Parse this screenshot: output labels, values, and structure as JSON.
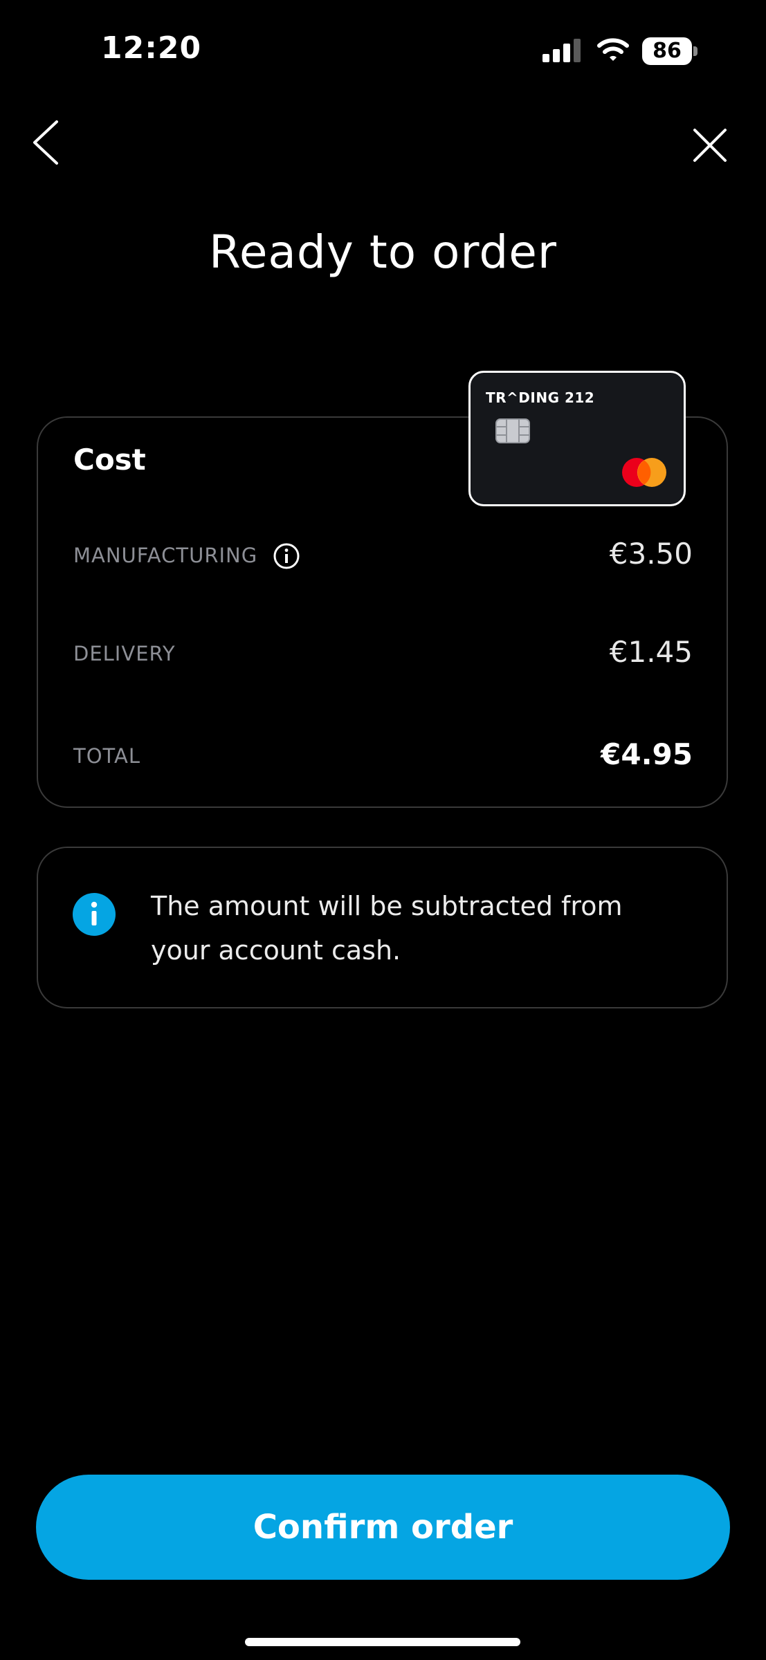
{
  "status_bar": {
    "time": "12:20",
    "battery": "86"
  },
  "page": {
    "title": "Ready to order"
  },
  "card_graphic": {
    "brand": "TR^DING 212"
  },
  "cost": {
    "heading": "Cost",
    "rows": [
      {
        "label": "MANUFACTURING",
        "value": "€3.50"
      },
      {
        "label": "DELIVERY",
        "value": "€1.45"
      },
      {
        "label": "TOTAL",
        "value": "€4.95"
      }
    ]
  },
  "info": {
    "text": "The amount will be subtracted from your account cash."
  },
  "actions": {
    "confirm_label": "Confirm order"
  },
  "colors": {
    "accent": "#05a5e3",
    "background": "#000000",
    "muted_text": "#8d8f96",
    "border": "#3a3a3a"
  },
  "icons": [
    "signal-icon",
    "wifi-icon",
    "battery-icon",
    "back-arrow-icon",
    "close-icon",
    "info-outline-icon",
    "info-filled-icon",
    "mastercard-logo",
    "chip-icon"
  ]
}
